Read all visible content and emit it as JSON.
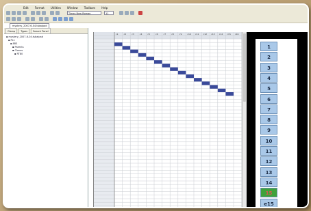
{
  "menu": [
    "Edit",
    "Format",
    "Utilities",
    "Window",
    "Toolbars",
    "Help"
  ],
  "toolbar": {
    "font_box": "Times New Roman",
    "size_box": "11"
  },
  "document_tab": "mystery_2007-6-04.tsbalpad",
  "left_panel": {
    "tabs": [
      "Clamp",
      "Types",
      "Search Panel"
    ],
    "tree": [
      "mystery_2007-6-04.tsbalpad",
      "PL1",
      "8R3",
      "Parents",
      "Clones",
      "RT80"
    ]
  },
  "grid": {
    "header_row_1": "Column Table",
    "header_row_2": "Trace in Table",
    "columns": [
      "c1",
      "c2",
      "c3",
      "c4",
      "c5",
      "c6",
      "c7",
      "c8",
      "c9",
      "c10",
      "c11",
      "c12",
      "c13",
      "c14",
      "c15",
      "c16"
    ],
    "row_count": 48,
    "diagonal_cells": 15,
    "accent": "#3a4a9a"
  },
  "sequence_panel": {
    "items": [
      "1",
      "2",
      "3",
      "4",
      "5",
      "6",
      "7",
      "8",
      "9",
      "10",
      "11",
      "12",
      "13",
      "14",
      "15",
      "e15"
    ],
    "highlight_index": 14,
    "chip_color": "#a9c8e8",
    "highlight_color": "#3fa23a"
  }
}
